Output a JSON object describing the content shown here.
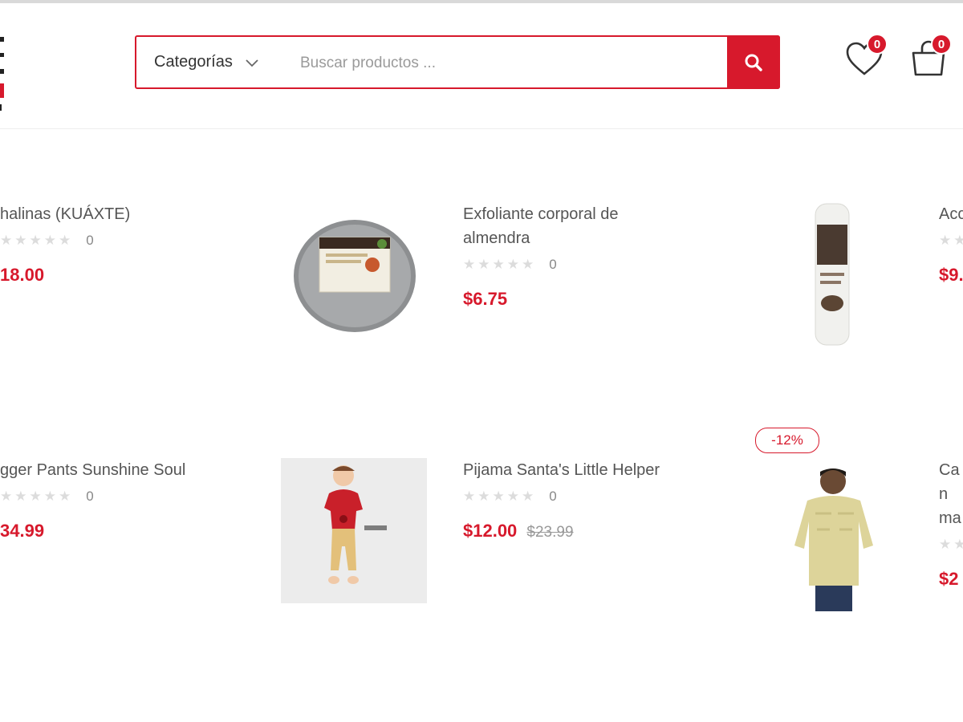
{
  "header": {
    "categories_label": "Categorías",
    "search_placeholder": "Buscar productos ...",
    "wishlist_count": "0",
    "cart_count": "0"
  },
  "products": [
    {
      "title": "halinas (KUÁXTE)",
      "rating_count": "0",
      "price": "18.00"
    },
    {
      "title": "Exfoliante corporal de almendra",
      "rating_count": "0",
      "price": "$6.75"
    },
    {
      "title": "Acc",
      "rating_count": "",
      "price": "$9."
    },
    {
      "title": "gger Pants Sunshine Soul",
      "rating_count": "0",
      "price": "34.99"
    },
    {
      "title": "Pijama Santa's Little Helper",
      "rating_count": "0",
      "price": "$12.00",
      "old_price": "$23.99"
    },
    {
      "title": "Can ma",
      "rating_count": "",
      "price": "$2"
    }
  ],
  "sale_badge": "-12%",
  "colors": {
    "accent": "#d7192c",
    "text": "#555555",
    "star": "#dcdcdc"
  }
}
